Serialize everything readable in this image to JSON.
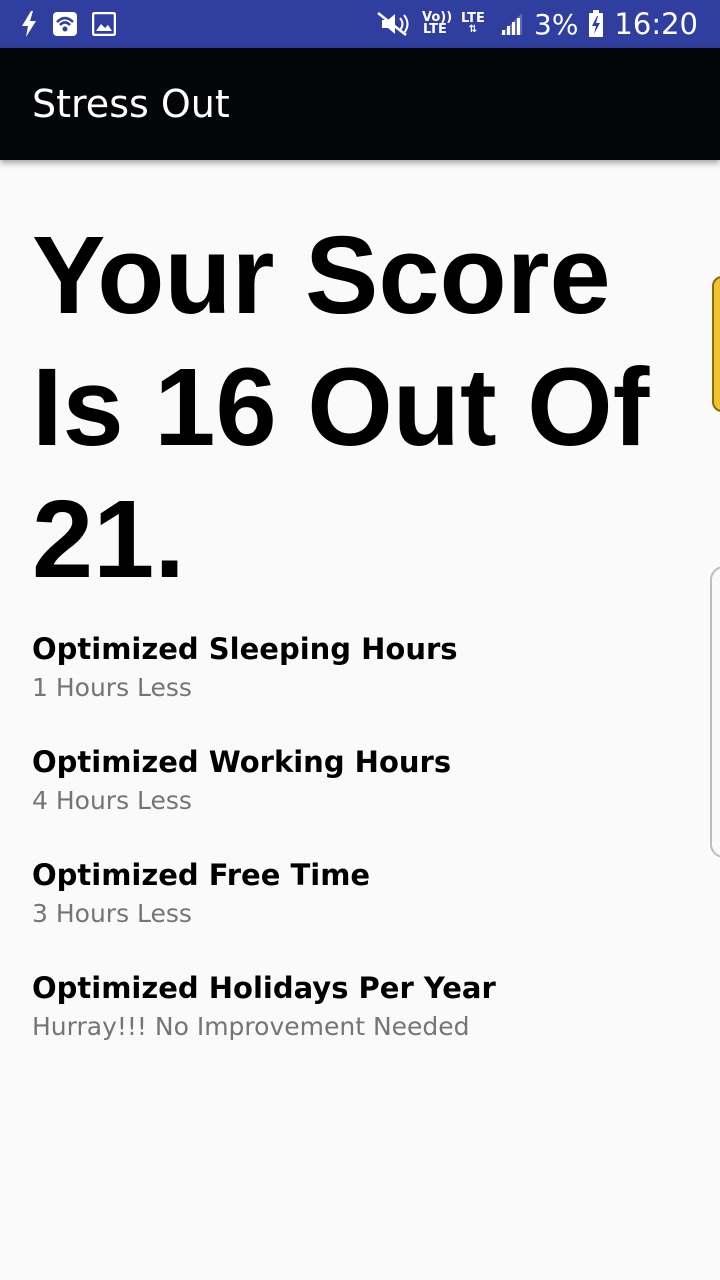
{
  "status_bar": {
    "battery_percent": "3%",
    "time": "16:20",
    "volte_label": "Vo)) LTE",
    "lte_label": "LTE",
    "icons": [
      "flash-icon",
      "wifi-hotspot-icon",
      "image-icon",
      "mute-icon",
      "volte-icon",
      "lte-icon",
      "signal-icon",
      "battery-charging-icon"
    ],
    "background_color": "#303f9f"
  },
  "app_bar": {
    "title": "Stress Out",
    "background_color": "#030509"
  },
  "main": {
    "score_heading": "Your Score Is 16 Out Of 21.",
    "results": [
      {
        "title": "Optimized Sleeping Hours",
        "value": "1 Hours Less"
      },
      {
        "title": "Optimized Working Hours",
        "value": "4 Hours Less"
      },
      {
        "title": "Optimized Free Time",
        "value": "3 Hours Less"
      },
      {
        "title": "Optimized Holidays Per Year",
        "value": "Hurray!!! No Improvement Needed"
      }
    ]
  },
  "edge_elements": {
    "tab_color": "#f2c230"
  }
}
